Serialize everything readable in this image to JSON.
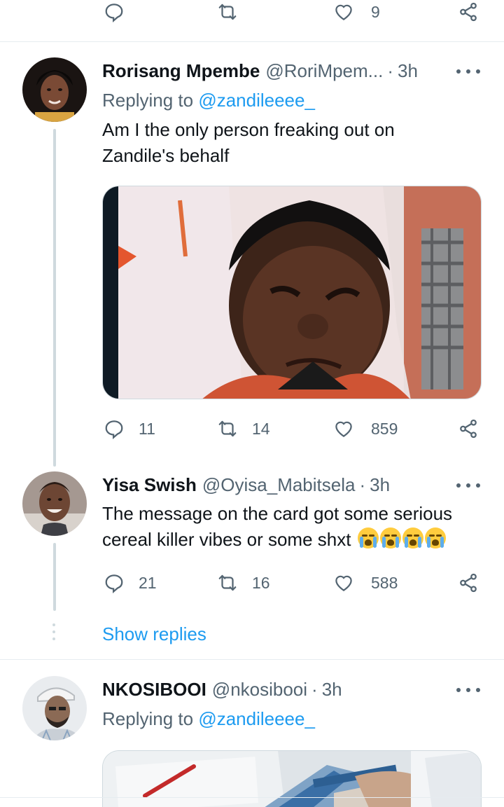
{
  "top_actions": {
    "likes": "9"
  },
  "tweets": [
    {
      "name": "Rorisang Mpembe",
      "handle": "@RoriMpem...",
      "separator": "·",
      "time": "3h",
      "replying_prefix": "Replying to",
      "replying_to": "@zandileeee_",
      "text_line1": "Am I the only person freaking out on",
      "text_line2": "Zandile's behalf",
      "replies": "11",
      "retweets": "14",
      "likes": "859"
    },
    {
      "name": "Yisa Swish",
      "handle": "@Oyisa_Mabitsela",
      "separator": "·",
      "time": "3h",
      "text_line1": "The message on the card got some serious",
      "text_line2": "cereal killer vibes or some shxt",
      "emojis": [
        "loudly-crying-face",
        "loudly-crying-face",
        "loudly-crying-face",
        "loudly-crying-face"
      ],
      "replies": "21",
      "retweets": "16",
      "likes": "588"
    },
    {
      "name": "NKOSIBOOI",
      "handle": "@nkosibooi",
      "separator": "·",
      "time": "3h",
      "replying_prefix": "Replying to",
      "replying_to": "@zandileeee_"
    }
  ],
  "show_replies": "Show replies",
  "colors": {
    "link": "#1d9bf0",
    "muted": "#536471",
    "text": "#0f1419",
    "thread_line": "#cfd9de"
  }
}
